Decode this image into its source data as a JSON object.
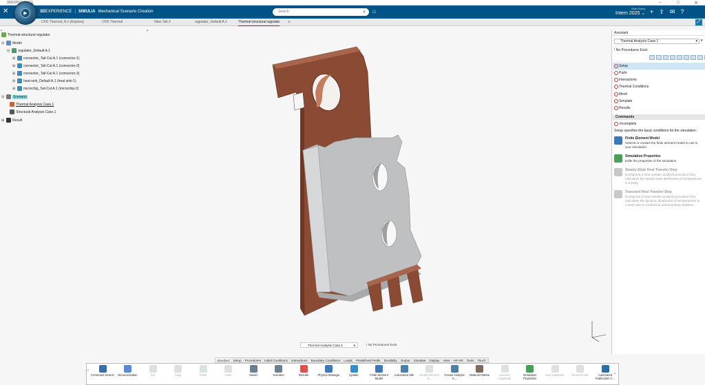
{
  "window": {
    "title": "3DEXPERIENCE"
  },
  "header": {
    "brand_3d": "3D",
    "brand_experience": "EXPERIENCE",
    "brand_sep": "|",
    "brand_app": "SIMULIA",
    "brand_role": "Mechanical Scenario Creation",
    "search_placeholder": "Search",
    "user_name": "Bilal Hunky",
    "version": "Intern 2025"
  },
  "tabs": [
    {
      "label": "CFD Thermal_A.1 (Explore)"
    },
    {
      "label": "CFD Thermal"
    },
    {
      "label": "New Tab 2"
    },
    {
      "label": "regulator_Default A.1"
    },
    {
      "label": "Thermal-structural regulato"
    }
  ],
  "tree": {
    "root": "Thermal-structural regulator",
    "model": "Model",
    "regulator": "regulator_Default A.1",
    "parts": [
      "connector_Tail-Cut A.1 (connector-1)",
      "connector_Tail-Cut A.1 (connector-2)",
      "connector_Tail-Cut A.1 (connector-3)",
      "heat-sink_Default A.1 (heat sink-1)",
      "microchip_Tail-Cut A.1 (microchip-2)"
    ],
    "scenario": "Scenario",
    "cases": [
      "Thermal Analysis Case.1",
      "Structural Analysis Case.1"
    ],
    "result": "Result"
  },
  "assistant": {
    "title": "Assistant",
    "selected_case": "Thermal Analysis Case.1",
    "no_procedures": "No Procedures Exist",
    "procedures": [
      "Setup",
      "Parts",
      "Interactions",
      "Thermal Conditions",
      "Mesh",
      "Simulate",
      "Results"
    ],
    "commands_header": "Commands",
    "status": "Incomplete",
    "setup_desc": "Setup specifies the basic conditions for the simulation.",
    "commands": [
      {
        "title": "Finite Element Model",
        "desc": "Selects or creates the finite element model to use in your simulation."
      },
      {
        "title": "Simulation Properties",
        "desc": "Edits the properties of the simulation."
      },
      {
        "title": "Steady-State Heat Transfer Step",
        "desc": "Configures a heat transfer analysis procedure that calculates the steady-state distribution of temperatures in a body."
      },
      {
        "title": "Transient Heat Transfer Step",
        "desc": "Configures a heat transfer analysis procedure that calculates the dynamic distribution of temperatures in a body due to conduction and boundary radiation."
      }
    ]
  },
  "viewport": {
    "procedure_select": "Thermal Analysis Case.1",
    "procedure_note": "No Procedures Exist"
  },
  "command_tabs": [
    "Standard",
    "Setup",
    "Procedures",
    "Initial Conditions",
    "Interactions",
    "Boundary Conditions",
    "Loads",
    "Predefined Fields",
    "Durability",
    "Output",
    "Simulate",
    "Display",
    "View",
    "AR-VR",
    "Tools",
    "Touch"
  ],
  "actions": [
    {
      "label": "Command Search",
      "icon": "command-search-icon",
      "dim": false
    },
    {
      "label": "Documentation",
      "icon": "documentation-icon",
      "dim": false
    },
    {
      "label": "Cut",
      "icon": "cut-icon",
      "dim": true
    },
    {
      "label": "Copy",
      "icon": "copy-icon",
      "dim": true
    },
    {
      "label": "Paste",
      "icon": "paste-icon",
      "dim": true
    },
    {
      "label": "Undo",
      "icon": "undo-icon",
      "dim": true
    },
    {
      "label": "Model",
      "icon": "model-icon",
      "dim": false
    },
    {
      "label": "Scenario",
      "icon": "scenario-icon",
      "dim": false
    },
    {
      "label": "Results",
      "icon": "results-icon",
      "dim": false
    },
    {
      "label": "Physics Manager",
      "icon": "physics-manager-icon",
      "dim": false
    },
    {
      "label": "Update",
      "icon": "update-icon",
      "dim": false
    },
    {
      "label": "Finite Element Model",
      "icon": "fem-icon",
      "dim": false
    },
    {
      "label": "Automated Idle",
      "icon": "automated-idle-icon",
      "dim": false
    },
    {
      "label": "Global Element Ty...",
      "icon": "global-element-icon",
      "dim": true
    },
    {
      "label": "Create Analysis C...",
      "icon": "create-analysis-icon",
      "dim": false
    },
    {
      "label": "Material Palette",
      "icon": "material-palette-icon",
      "dim": false
    },
    {
      "label": "General Amplitude",
      "icon": "amplitude-icon",
      "dim": true
    },
    {
      "label": "Simulation Properties",
      "icon": "sim-properties-icon",
      "dim": false
    },
    {
      "label": "New Substrate",
      "icon": "substrate-icon",
      "dim": true
    },
    {
      "label": "Reorient Edit",
      "icon": "reorient-icon",
      "dim": true
    },
    {
      "label": "Automated Publication C...",
      "icon": "publication-icon",
      "dim": false
    }
  ],
  "colors": {
    "brand": "#005386",
    "copper": "#8a4a34",
    "housing": "#bfc0c2",
    "highlight": "#8ddbe8"
  }
}
